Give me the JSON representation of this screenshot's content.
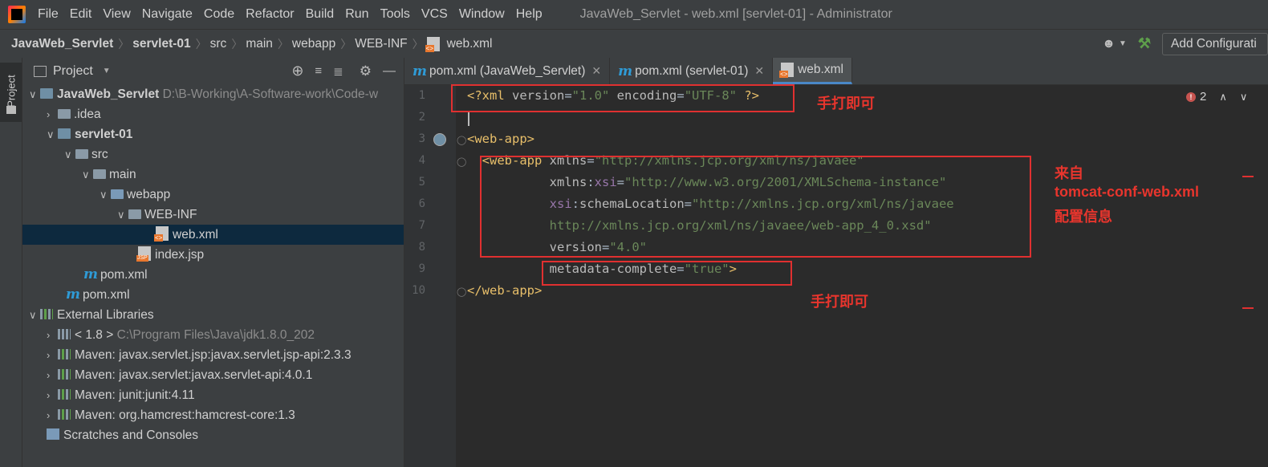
{
  "menubar": {
    "items": [
      "File",
      "Edit",
      "View",
      "Navigate",
      "Code",
      "Refactor",
      "Build",
      "Run",
      "Tools",
      "VCS",
      "Window",
      "Help"
    ],
    "window_title": "JavaWeb_Servlet - web.xml [servlet-01] - Administrator"
  },
  "navbar": {
    "crumbs": [
      "JavaWeb_Servlet",
      "servlet-01",
      "src",
      "main",
      "webapp",
      "WEB-INF",
      "web.xml"
    ],
    "add_config": "Add Configurati"
  },
  "stripe": {
    "project_label": "Project"
  },
  "project_panel": {
    "title": "Project",
    "tree": {
      "root": {
        "name": "JavaWeb_Servlet",
        "path": "D:\\B-Working\\A-Software-work\\Code-w"
      },
      "idea": ".idea",
      "servlet01": "servlet-01",
      "src": "src",
      "main": "main",
      "webapp": "webapp",
      "webinf": "WEB-INF",
      "webxml": "web.xml",
      "indexjsp": "index.jsp",
      "pom_module": "pom.xml",
      "pom_root": "pom.xml",
      "external_libraries": "External Libraries",
      "jdk": {
        "name": "< 1.8 >",
        "path": "C:\\Program Files\\Java\\jdk1.8.0_202"
      },
      "libs": [
        "Maven: javax.servlet.jsp:javax.servlet.jsp-api:2.3.3",
        "Maven: javax.servlet:javax.servlet-api:4.0.1",
        "Maven: junit:junit:4.11",
        "Maven: org.hamcrest:hamcrest-core:1.3"
      ],
      "scratches": "Scratches and Consoles"
    }
  },
  "editor": {
    "tabs": [
      "pom.xml (JavaWeb_Servlet)",
      "pom.xml (servlet-01)",
      "web.xml"
    ],
    "active_tab": "web.xml",
    "error_count": "2",
    "line_numbers": [
      "1",
      "2",
      "3",
      "4",
      "5",
      "6",
      "7",
      "8",
      "9",
      "10"
    ],
    "code": {
      "l1": [
        "<?xml ",
        "version",
        "=",
        "\"1.0\"",
        " encoding",
        "=",
        "\"UTF-8\"",
        " ?>"
      ],
      "l3": "<web-app>",
      "l4": {
        "tag": "<web-app ",
        "attr": "xmlns",
        "eq": "=",
        "val": "\"http://xmlns.jcp.org/xml/ns/javaee\""
      },
      "l5": {
        "ns": "xmlns",
        "colon": ":",
        "attr": "xsi",
        "eq": "=",
        "val": "\"http://www.w3.org/2001/XMLSchema-instance\""
      },
      "l6": {
        "ns": "xsi",
        "colon": ":",
        "attr": "schemaLocation",
        "eq": "=",
        "val": "\"http://xmlns.jcp.org/xml/ns/javaee"
      },
      "l7": {
        "val": "http://xmlns.jcp.org/xml/ns/javaee/web-app_4_0.xsd\""
      },
      "l8": {
        "attr": "version",
        "eq": "=",
        "val": "\"4.0\""
      },
      "l9": {
        "attr": "metadata-complete",
        "eq": "=",
        "val": "\"true\"",
        "close": ">"
      },
      "l10": "</web-app>"
    }
  },
  "annotations": {
    "note1": "手打即可",
    "note2_line1": "来自",
    "note2_line2": "tomcat-conf-web.xml",
    "note2_line3": "配置信息",
    "note3": "手打即可"
  },
  "colors": {
    "annotation_red": "#e03030",
    "tag": "#e8bf6a",
    "string": "#6a8759",
    "namespace": "#9876aa"
  }
}
